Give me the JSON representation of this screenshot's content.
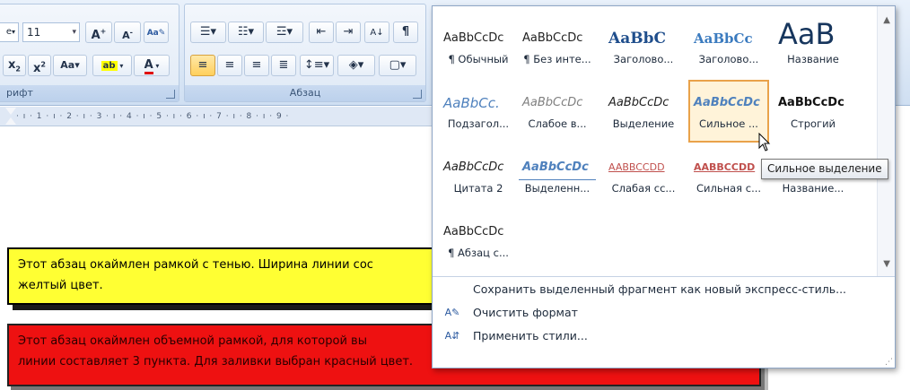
{
  "ribbon": {
    "font_group_label": "рифт",
    "para_group_label": "Абзац",
    "font_size": "11",
    "font_name_stub": "е"
  },
  "ruler": {
    "ticks": "· ı · 1 · ı · 2 · ı · 3 · ı · 4 · ı · 5 · ı · 6 · ı · 7 · ı · 8 · ı · 9 ·"
  },
  "document": {
    "yellow_paragraph": "Этот абзац окаймлен рамкой с тенью. Ширина линии сос",
    "yellow_paragraph_line2": "желтый цвет.",
    "red_paragraph": "Этот абзац окаймлен объемной рамкой, для которой вы",
    "red_paragraph_line2": "линии составляет 3 пункта. Для заливки выбран красный цвет."
  },
  "gallery": {
    "styles": [
      {
        "sample": "AaBbCcDc",
        "name": "¶ Обычный"
      },
      {
        "sample": "AaBbCcDc",
        "name": "¶ Без инте..."
      },
      {
        "sample": "AaBbC",
        "name": "Заголово..."
      },
      {
        "sample": "AaBbCc",
        "name": "Заголово..."
      },
      {
        "sample": "AaB",
        "name": "Название"
      },
      {
        "sample": "AaBbCc.",
        "name": "Подзагол..."
      },
      {
        "sample": "AaBbCcDc",
        "name": "Слабое в..."
      },
      {
        "sample": "AaBbCcDc",
        "name": "Выделение"
      },
      {
        "sample": "AaBbCcDc",
        "name": "Сильное ..."
      },
      {
        "sample": "AaBbCcDc",
        "name": "Строгий"
      },
      {
        "sample": "AaBbCcDc",
        "name": "Цитата 2"
      },
      {
        "sample": "AaBbCcDc",
        "name": "Выделенн..."
      },
      {
        "sample": "AABBCCDD",
        "name": "Слабая сс..."
      },
      {
        "sample": "AABBCCDD",
        "name": "Сильная с..."
      },
      {
        "sample": "",
        "name": "Название..."
      },
      {
        "sample": "AaBbCcDc",
        "name": "¶ Абзац с..."
      }
    ],
    "menu": {
      "save_selection": "Сохранить выделенный фрагмент как новый экспресс-стиль...",
      "clear_format": "Очистить формат",
      "apply_styles": "Применить стили..."
    }
  },
  "tooltip": "Сильное выделение",
  "colors": {
    "accent_selected": "#e9a24a",
    "heading_blue": "#1f4e8c",
    "yellow_fill": "#ffff33",
    "red_fill": "#ee1111"
  }
}
